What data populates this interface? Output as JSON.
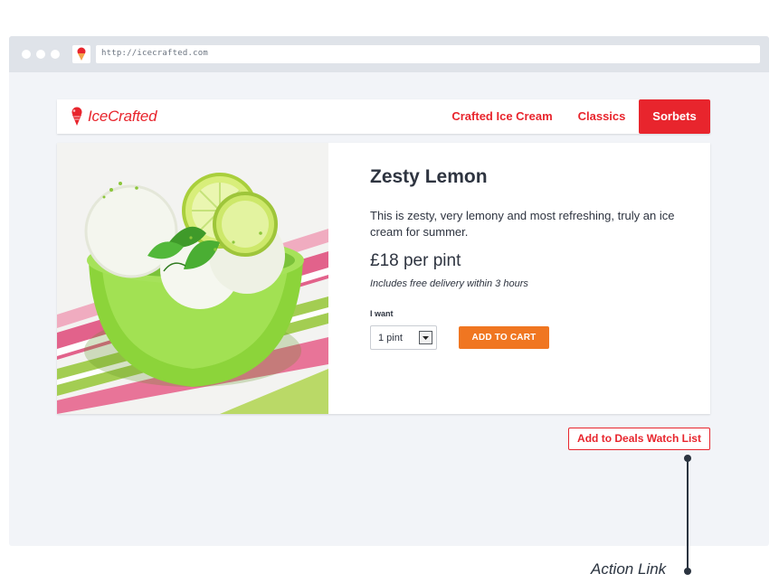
{
  "browser": {
    "url": "http://icecrafted.com"
  },
  "site": {
    "logo_text": "IceCrafted",
    "nav": [
      {
        "label": "Crafted Ice Cream",
        "active": false
      },
      {
        "label": "Classics",
        "active": false
      },
      {
        "label": "Sorbets",
        "active": true
      }
    ]
  },
  "product": {
    "name": "Zesty Lemon",
    "description": "This is zesty, very lemony and most refreshing, truly an ice cream for summer.",
    "price": "£18 per pint",
    "delivery_note": "Includes free delivery within 3 hours",
    "quantity_label": "I want",
    "quantity_value": "1 pint",
    "add_to_cart_label": "ADD TO CART"
  },
  "actions": {
    "deals_watch_label": "Add to Deals Watch List"
  },
  "annotation": {
    "label": "Action Link"
  },
  "colors": {
    "brand_red": "#e8252d",
    "cart_orange": "#f07621",
    "page_bg": "#f2f4f8",
    "text_dark": "#2e3440"
  },
  "icons": {
    "logo": "ice-cream-cone-icon",
    "favicon": "ice-cream-cone-icon",
    "select": "chevron-down-icon"
  }
}
